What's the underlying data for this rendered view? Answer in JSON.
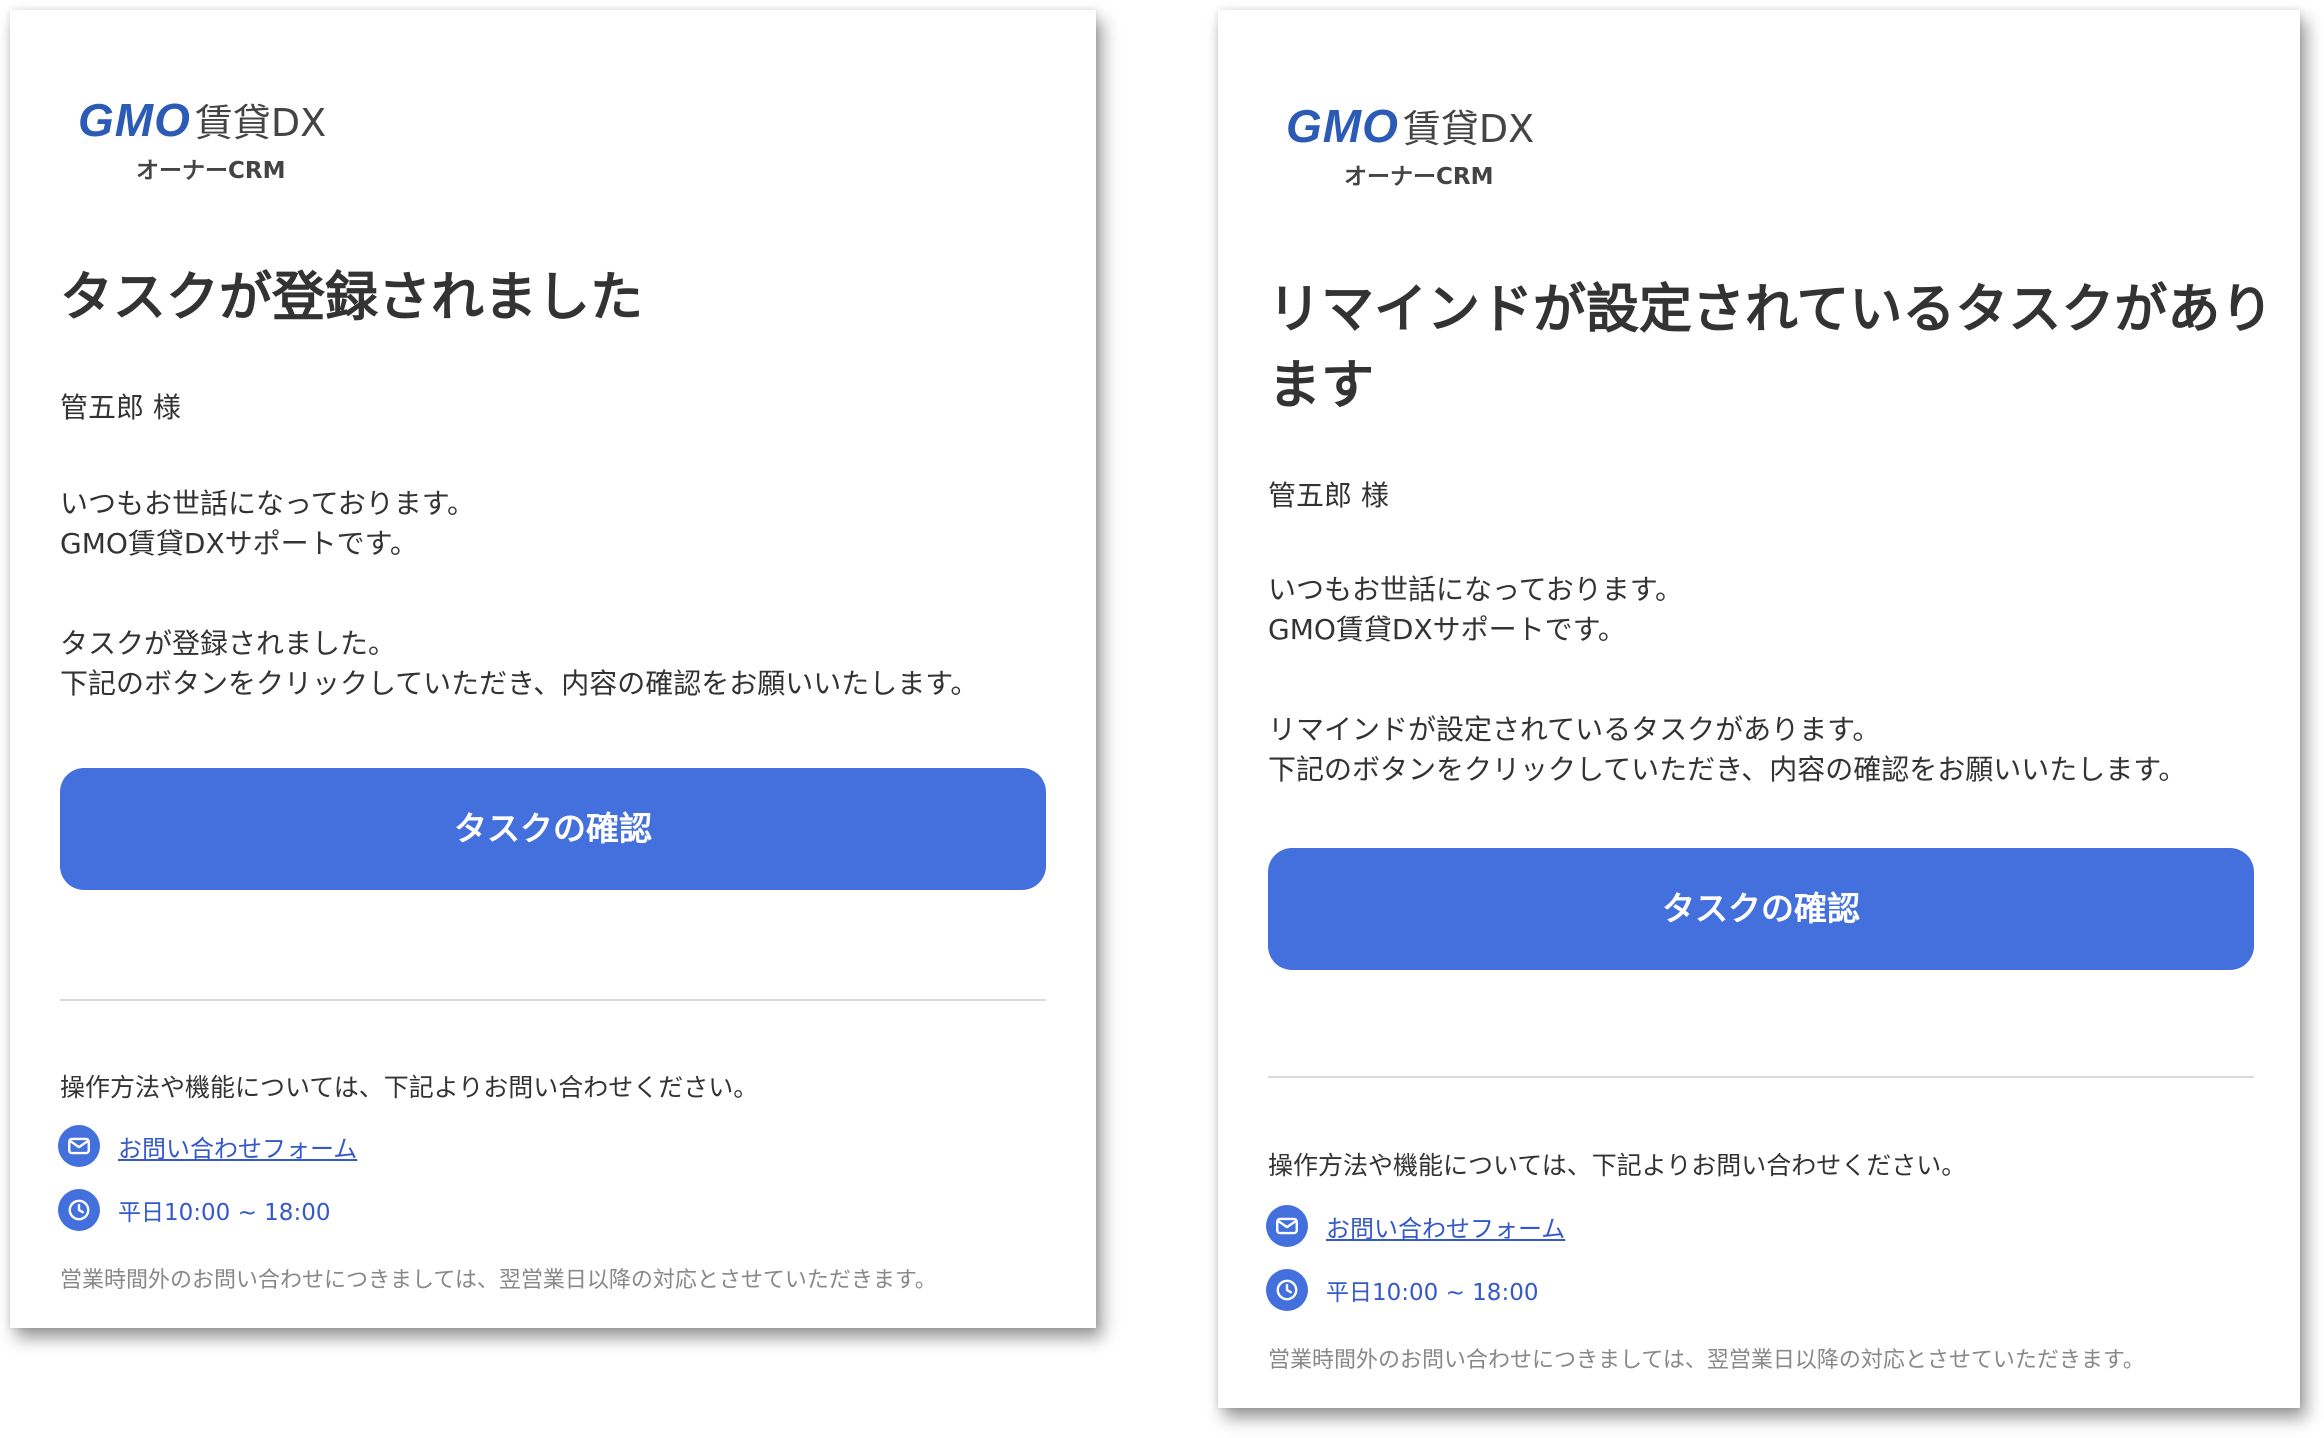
{
  "colors": {
    "accent": "#4470dd",
    "link": "#3559c9",
    "logo_blue": "#2c5bb5",
    "text": "#333333",
    "muted": "#888888",
    "divider": "#d6d9de"
  },
  "left_email": {
    "logo": {
      "brand": "GMO",
      "product": "賃貸DX",
      "sub": "オーナーCRM"
    },
    "headline": "タスクが登録されました",
    "recipient": "管五郎 様",
    "greeting_line1": "いつもお世話になっております。",
    "greeting_line2": "GMO賃貸DXサポートです。",
    "body_line1": "タスクが登録されました。",
    "body_line2": "下記のボタンをクリックしていただき、内容の確認をお願いいたします。",
    "button_label": "タスクの確認",
    "contact_intro": "操作方法や機能については、下記よりお問い合わせください。",
    "contact_form_label": "お問い合わせフォーム",
    "contact_form_icon": "mail-icon",
    "hours_label": "平日10:00 ~ 18:00",
    "hours_icon": "clock-icon",
    "footnote": "営業時間外のお問い合わせにつきましては、翌営業日以降の対応とさせていただきます。"
  },
  "right_email": {
    "logo": {
      "brand": "GMO",
      "product": "賃貸DX",
      "sub": "オーナーCRM"
    },
    "headline_line1": "リマインドが設定されているタスクがあり",
    "headline_line2": "ます",
    "recipient": "管五郎 様",
    "greeting_line1": "いつもお世話になっております。",
    "greeting_line2": "GMO賃貸DXサポートです。",
    "body_line1": "リマインドが設定されているタスクがあります。",
    "body_line2": "下記のボタンをクリックしていただき、内容の確認をお願いいたします。",
    "button_label": "タスクの確認",
    "contact_intro": "操作方法や機能については、下記よりお問い合わせください。",
    "contact_form_label": "お問い合わせフォーム",
    "contact_form_icon": "mail-icon",
    "hours_label": "平日10:00 ~ 18:00",
    "hours_icon": "clock-icon",
    "footnote": "営業時間外のお問い合わせにつきましては、翌営業日以降の対応とさせていただきます。"
  }
}
